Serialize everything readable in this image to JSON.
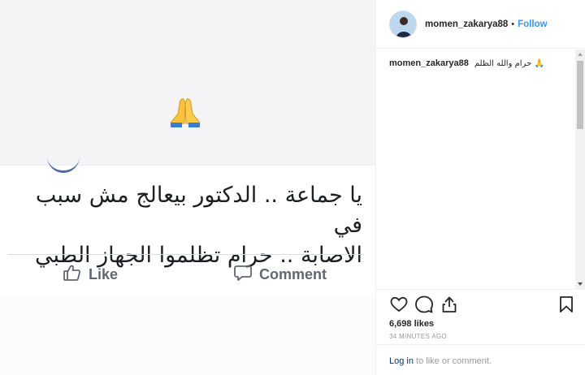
{
  "post": {
    "image": {
      "emoji": "folded-hands",
      "fb_text_line1": "يا جماعة .. الدكتور بيعالج مش سبب في",
      "fb_text_line2": "الاصابة .. حرام تظلموا الجهاز الطبي",
      "like_label": "Like",
      "comment_label": "Comment"
    }
  },
  "sidebar": {
    "header": {
      "username": "momen_zakarya88",
      "separator": "•",
      "follow_label": "Follow"
    },
    "caption": {
      "username": "momen_zakarya88",
      "text": "حرام والله الظلم 🙏"
    },
    "actions": {
      "likes": "6,698 likes",
      "timestamp": "34 MINUTES AGO"
    },
    "login": {
      "link_label": "Log in",
      "rest": " to like or comment."
    }
  },
  "colors": {
    "accent": "#3897f0",
    "facebook_blue": "#3b5998",
    "muted": "#999999"
  }
}
